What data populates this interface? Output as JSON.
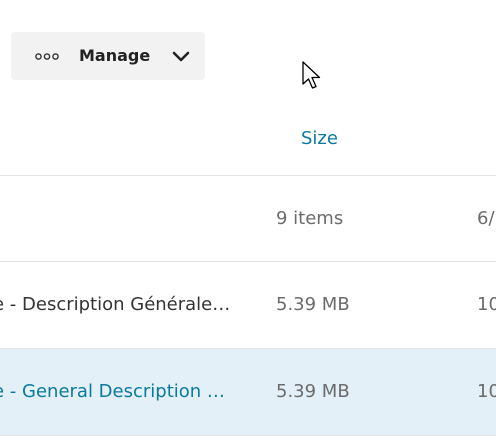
{
  "toolbar": {
    "manage_label": "Manage"
  },
  "icons": {
    "manage_dots": "more-dots-icon",
    "manage_chevron": "chevron-down-icon",
    "cursor": "mouse-pointer-icon"
  },
  "table": {
    "columns": {
      "size": "Size"
    },
    "rows": [
      {
        "name": "",
        "size": "9 items",
        "modified": "6/"
      },
      {
        "name": "e - Description Générale…",
        "size": "5.39 MB",
        "modified": "10"
      },
      {
        "name": "e - General Description …",
        "size": "5.39 MB",
        "modified": "10",
        "selected": true
      }
    ]
  },
  "colors": {
    "link": "#0b7a9e",
    "selected_row": "#e3f0f7",
    "button_bg": "#f2f2f2"
  }
}
